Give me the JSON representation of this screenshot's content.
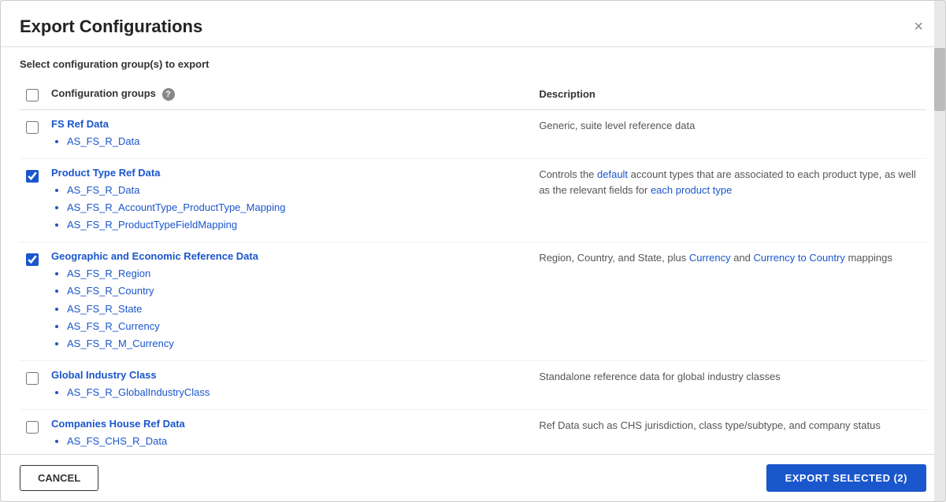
{
  "modal": {
    "title": "Export Configurations",
    "close_label": "×",
    "section_label": "Select configuration group(s) to export"
  },
  "table": {
    "header_checkbox": "",
    "col_config": "Configuration groups",
    "col_description": "Description",
    "help_icon": "?"
  },
  "rows": [
    {
      "id": "row-header-check",
      "checked": false,
      "group_title": "",
      "items": [],
      "description": ""
    },
    {
      "id": "fs-ref-data",
      "checked": false,
      "group_title": "FS Ref Data",
      "items": [
        "AS_FS_R_Data"
      ],
      "description": "Generic, suite level reference data"
    },
    {
      "id": "product-type-ref-data",
      "checked": true,
      "group_title": "Product Type Ref Data",
      "items": [
        "AS_FS_R_Data",
        "AS_FS_R_AccountType_ProductType_Mapping",
        "AS_FS_R_ProductTypeFieldMapping"
      ],
      "description_parts": [
        {
          "text": "Controls the ",
          "highlight": false
        },
        {
          "text": "default",
          "highlight": true
        },
        {
          "text": " account types that are associated to each product type, as well as the relevant fields for ",
          "highlight": false
        },
        {
          "text": "each product type",
          "highlight": true
        }
      ]
    },
    {
      "id": "geo-econ-ref-data",
      "checked": true,
      "group_title": "Geographic and Economic Reference Data",
      "items": [
        "AS_FS_R_Region",
        "AS_FS_R_Country",
        "AS_FS_R_State",
        "AS_FS_R_Currency",
        "AS_FS_R_M_Currency"
      ],
      "description_parts": [
        {
          "text": "Region, Country, and State, plus ",
          "highlight": false
        },
        {
          "text": "Currency",
          "highlight": true
        },
        {
          "text": " and ",
          "highlight": false
        },
        {
          "text": "Currency to Country",
          "highlight": true
        },
        {
          "text": " mappings",
          "highlight": false
        }
      ]
    },
    {
      "id": "global-industry",
      "checked": false,
      "group_title": "Global Industry Class",
      "items": [
        "AS_FS_R_GlobalIndustryClass"
      ],
      "description": "Standalone reference data for global industry classes"
    },
    {
      "id": "companies-house",
      "checked": false,
      "group_title": "Companies House Ref Data",
      "items": [
        "AS_FS_CHS_R_Data"
      ],
      "description": "Ref Data such as CHS jurisdiction, class type/subtype, and company status"
    }
  ],
  "footer": {
    "cancel_label": "CANCEL",
    "export_label": "EXPORT SELECTED (2)"
  }
}
